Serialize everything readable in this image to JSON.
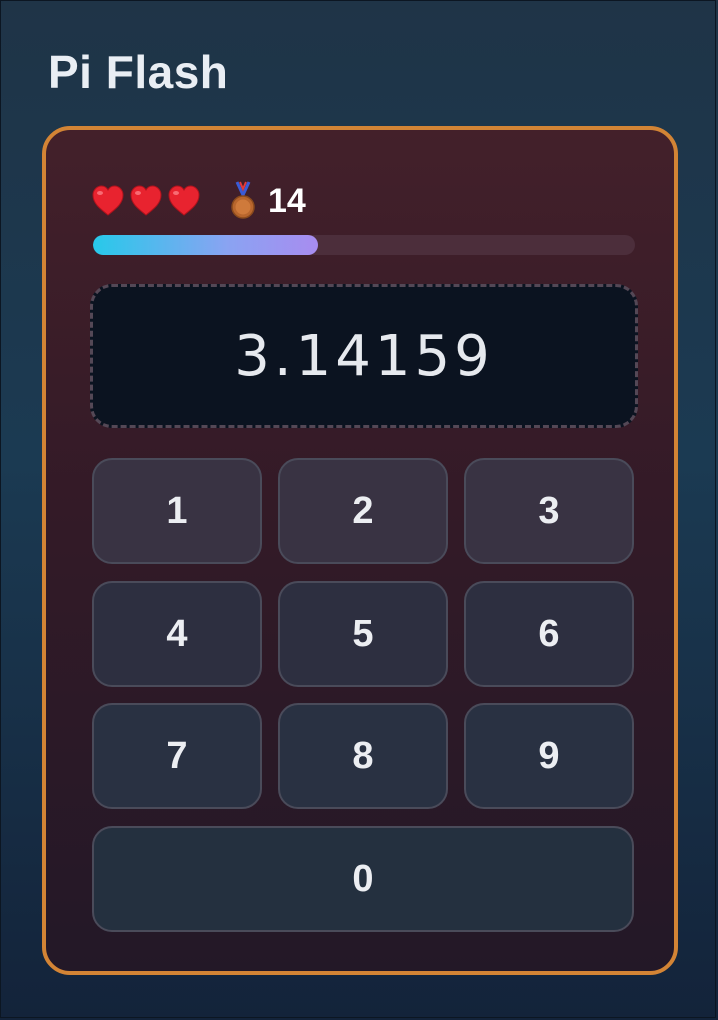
{
  "app": {
    "title": "Pi Flash"
  },
  "status": {
    "lives": 3,
    "icons": {
      "life": "heart-icon",
      "rank": "bronze-medal-icon"
    },
    "score": "14",
    "progress": 0.415
  },
  "display": {
    "value": "3.14159"
  },
  "keypad": {
    "k1": "1",
    "k2": "2",
    "k3": "3",
    "k4": "4",
    "k5": "5",
    "k6": "6",
    "k7": "7",
    "k8": "8",
    "k9": "9",
    "k0": "0"
  },
  "colors": {
    "card_border": "#d38435",
    "progress_start": "#27c9ea",
    "progress_end": "#a88cf0",
    "heart": "#e8232f"
  }
}
